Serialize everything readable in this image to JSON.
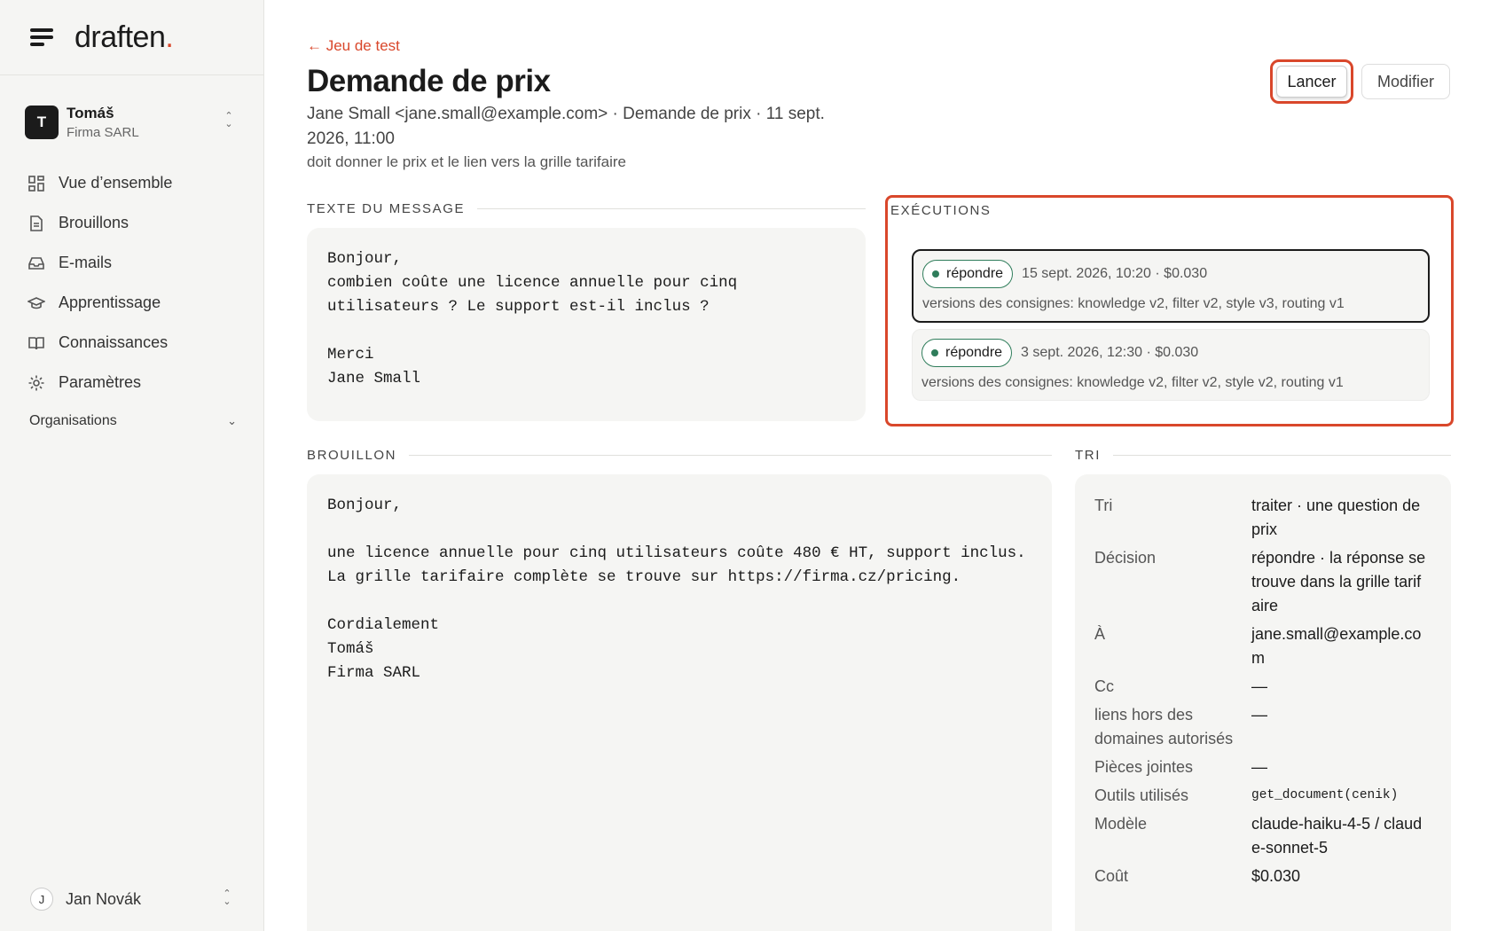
{
  "app": {
    "logo_text": "draften",
    "logo_dot": "."
  },
  "org": {
    "initial": "T",
    "name": "Tomáš",
    "company": "Firma SARL"
  },
  "nav": [
    {
      "label": "Vue d’ensemble",
      "icon": "grid-icon"
    },
    {
      "label": "Brouillons",
      "icon": "document-icon"
    },
    {
      "label": "E-mails",
      "icon": "inbox-icon"
    },
    {
      "label": "Apprentissage",
      "icon": "graduation-cap-icon"
    },
    {
      "label": "Connaissances",
      "icon": "book-icon"
    },
    {
      "label": "Paramètres",
      "icon": "gear-icon"
    }
  ],
  "organisations_label": "Organisations",
  "user": {
    "initial": "J",
    "name": "Jan Novák"
  },
  "page": {
    "back_label": "← Jeu de test",
    "title": "Demande de prix",
    "meta": "Jane Small <jane.small@example.com> · Demande de prix · 11 sept. 2026, 11:00",
    "description": "doit donner le prix et le lien vers la grille tarifaire",
    "lancer_label": "Lancer",
    "modifier_label": "Modifier"
  },
  "message": {
    "section_label": "TEXTE DU MESSAGE",
    "body": "Bonjour,\ncombien coûte une licence annuelle pour cinq\nutilisateurs ? Le support est-il inclus ?\n\nMerci\nJane Small"
  },
  "executions": {
    "section_label": "EXÉCUTIONS",
    "runs": [
      {
        "status": "répondre",
        "meta": "15 sept. 2026, 10:20 · $0.030",
        "versions": "versions des consignes: knowledge v2, filter v2, style v3, routing v1",
        "selected": true
      },
      {
        "status": "répondre",
        "meta": "3 sept. 2026, 12:30 · $0.030",
        "versions": "versions des consignes: knowledge v2, filter v2, style v2, routing v1",
        "selected": false
      }
    ]
  },
  "draft": {
    "section_label": "BROUILLON",
    "body": "Bonjour,\n\nune licence annuelle pour cinq utilisateurs coûte 480 € HT, support inclus.\nLa grille tarifaire complète se trouve sur https://firma.cz/pricing.\n\nCordialement\nTomáš\nFirma SARL"
  },
  "tri": {
    "section_label": "TRI",
    "rows": [
      {
        "key": "Tri",
        "value": "traiter · une question de prix"
      },
      {
        "key": "Décision",
        "value": "répondre · la réponse se trouve dans la grille tarifaire"
      },
      {
        "key": "À",
        "value": "jane.small@example.com"
      },
      {
        "key": "Cc",
        "value": "—"
      },
      {
        "key": "liens hors des domaines autorisés",
        "value": "—"
      },
      {
        "key": "Pièces jointes",
        "value": "—"
      },
      {
        "key": "Outils utilisés",
        "value": "get_document(cenik)"
      },
      {
        "key": "Modèle",
        "value": "claude-haiku-4-5 / claude-sonnet-5"
      },
      {
        "key": "Coût",
        "value": "$0.030"
      }
    ]
  },
  "colors": {
    "accent": "#d9472b",
    "status_green": "#2f7d5b"
  }
}
